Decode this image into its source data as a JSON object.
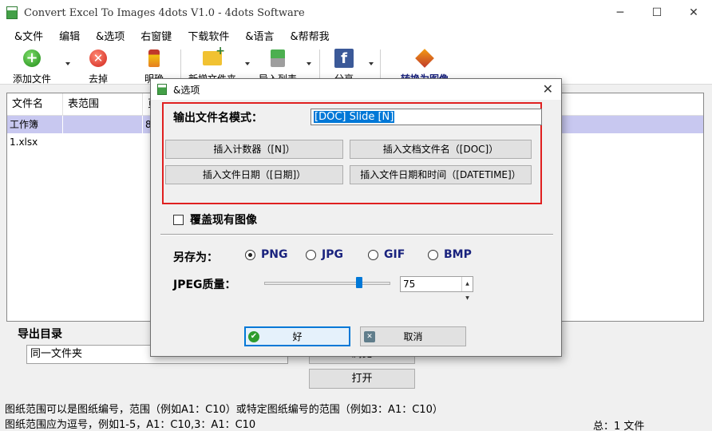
{
  "window": {
    "title": "Convert Excel To Images 4dots V1.0 - 4dots Software",
    "minimize": "─",
    "maximize": "☐",
    "close": "✕"
  },
  "menu": [
    "&文件",
    "编辑",
    "&选项",
    "右窗键",
    "下载软件",
    "&语言",
    "&帮帮我"
  ],
  "toolbar": {
    "add_files": "添加文件",
    "remove": "去掉",
    "clear": "明确",
    "new_folder": "新增文件夹",
    "import_list": "导入列表",
    "share": "分享",
    "convert": "转换为图像"
  },
  "list": {
    "columns": [
      "文件名",
      "表范围",
      "页"
    ],
    "rows": [
      {
        "filename": "工作簿1.xlsx",
        "range": "",
        "pages": "8"
      }
    ]
  },
  "export": {
    "label": "导出目录",
    "value": "同一文件夹",
    "browse_label": "浏览",
    "open_label": "打开"
  },
  "footer": {
    "line1": "图纸范围可以是图纸编号，范围（例如A1：C10）或特定图纸编号的范围（例如3：A1：C10）",
    "line2": "图纸范围应为逗号，例如1-5，A1：C10,3：A1：C10",
    "status": "总：1 文件"
  },
  "dialog": {
    "title": "&选项",
    "close": "✕",
    "pattern_label": "输出文件名模式：",
    "pattern_value": "[DOC] Slide [N]",
    "btn_counter": "插入计数器（[N]）",
    "btn_docname": "插入文档文件名（[DOC]）",
    "btn_date": "插入文件日期（[日期]）",
    "btn_datetime": "插入文件日期和时间（[DATETIME]）",
    "overwrite_label": "覆盖现有图像",
    "overwrite_checked": false,
    "saveas_label": "另存为：",
    "formats": [
      {
        "label": "PNG",
        "selected": true
      },
      {
        "label": "JPG",
        "selected": false
      },
      {
        "label": "GIF",
        "selected": false
      },
      {
        "label": "BMP",
        "selected": false
      }
    ],
    "jpeg_label": "JPEG质量：",
    "jpeg_quality": "75",
    "jpeg_quality_fraction": 0.75,
    "ok_label": "好",
    "cancel_label": "取消"
  }
}
